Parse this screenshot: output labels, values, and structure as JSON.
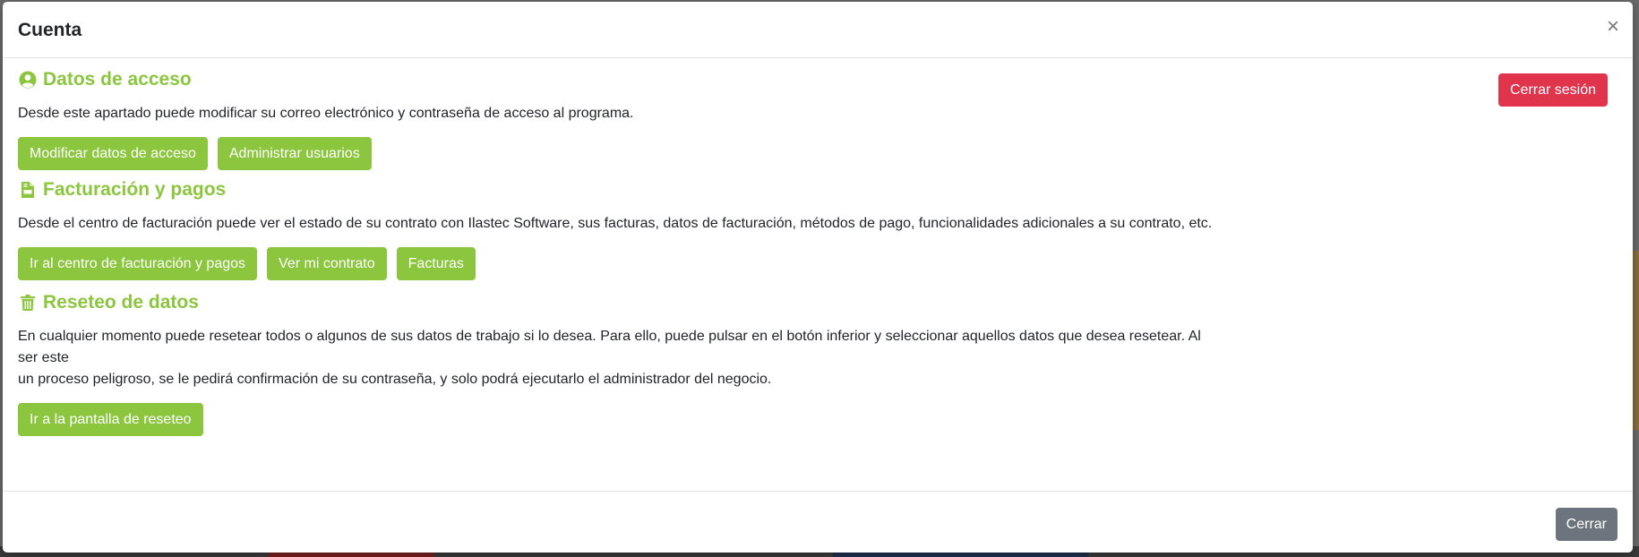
{
  "modal": {
    "title": "Cuenta",
    "close_symbol": "×"
  },
  "access": {
    "icon": "user-circle-icon",
    "title": "Datos de acceso",
    "description": "Desde este apartado puede modificar su correo electrónico y contraseña de acceso al programa.",
    "buttons": [
      "Modificar datos de acceso",
      "Administrar usuarios"
    ],
    "logout_label": "Cerrar sesión"
  },
  "billing": {
    "icon": "invoice-icon",
    "title": "Facturación y pagos",
    "description": "Desde el centro de facturación puede ver el estado de su contrato con Ilastec Software, sus facturas, datos de facturación, métodos de pago, funcionalidades adicionales a su contrato, etc.",
    "buttons": [
      "Ir al centro de facturación y pagos",
      "Ver mi contrato",
      "Facturas"
    ]
  },
  "reset": {
    "icon": "trash-icon",
    "title": "Reseteo de datos",
    "description_line1": "En cualquier momento puede resetear todos o algunos de sus datos de trabajo si lo desea. Para ello, puede pulsar en el botón inferior y seleccionar aquellos datos que desea resetear. Al ser este",
    "description_line2": "un proceso peligroso, se le pedirá confirmación de su contraseña, y solo podrá ejecutarlo el administrador del negocio.",
    "button": "Ir a la pantalla de reseteo"
  },
  "footer": {
    "close_label": "Cerrar"
  },
  "colors": {
    "accent_green": "#8cc63f",
    "danger_red": "#e0344d",
    "secondary_gray": "#6c757d"
  }
}
